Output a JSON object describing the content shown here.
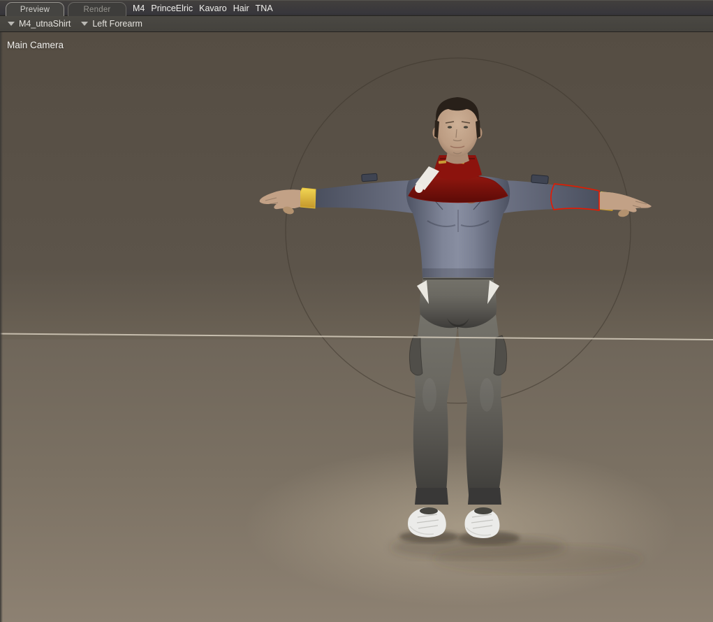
{
  "tab_bar": {
    "tabs": [
      {
        "label": "Preview",
        "active": true
      },
      {
        "label": "Render",
        "active": false
      }
    ],
    "figure_names": [
      "M4",
      "PrinceElric",
      "Kavaro",
      "Hair",
      "TNA"
    ]
  },
  "selector_bar": {
    "figure_selector": {
      "label": "M4_utnaShirt",
      "icon": "dropdown-triangle"
    },
    "actor_selector": {
      "label": "Left Forearm",
      "icon": "dropdown-triangle"
    }
  },
  "viewport": {
    "camera_label": "Main Camera",
    "selected_actor": "Left Forearm"
  },
  "colors": {
    "selection_highlight": "#e81800",
    "collar_red": "#7a100b",
    "collar_band_red": "#8c130d",
    "wristband_gold": "#e3bf3a",
    "shirt_gray_blue": "#7d8295",
    "pants_gray": "#6b6962",
    "shoe_white": "#ebebe9",
    "strap_white": "#ece9e3",
    "emblem_bronze": "#8d6a50",
    "viewport_top": "#564e44",
    "viewport_ground": "#8d8172"
  }
}
